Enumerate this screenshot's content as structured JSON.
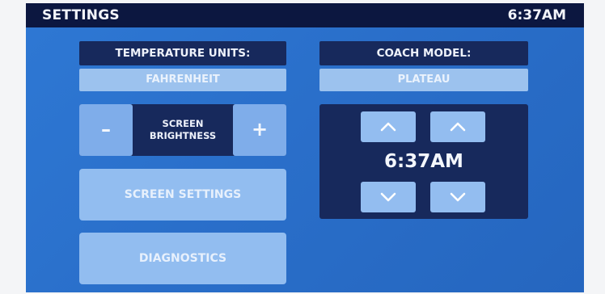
{
  "header": {
    "title": "SETTINGS",
    "time": "6:37AM"
  },
  "temperature_units": {
    "label": "TEMPERATURE UNITS:",
    "value": "FAHRENHEIT"
  },
  "coach_model": {
    "label": "COACH MODEL:",
    "value": "PLATEAU"
  },
  "brightness": {
    "minus_label": "–",
    "plus_label": "+",
    "label_line1": "SCREEN",
    "label_line2": "BRIGHTNESS"
  },
  "buttons": {
    "screen_settings": "SCREEN SETTINGS",
    "diagnostics": "DIAGNOSTICS"
  },
  "clock_setter": {
    "time": "6:37AM"
  },
  "icons": {
    "hour_up": "chevron-up-icon",
    "minute_up": "chevron-up-icon",
    "hour_down": "chevron-down-icon",
    "minute_down": "chevron-down-icon"
  },
  "colors": {
    "background": "#2a6fca",
    "header_bar": "#0c1740",
    "panel": "#17295c",
    "button": "#92bdf0",
    "text": "#eef2fb"
  }
}
